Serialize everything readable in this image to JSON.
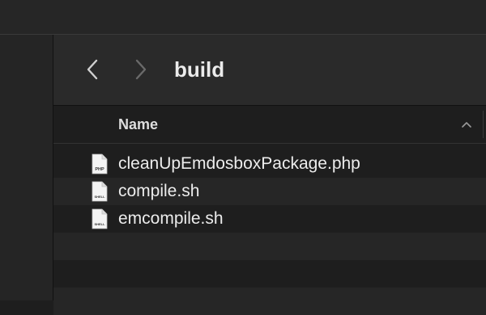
{
  "toolbar": {
    "folder_title": "build",
    "back_icon": "chevron-left-icon",
    "forward_icon": "chevron-right-icon"
  },
  "list": {
    "column_name": "Name",
    "sort": "ascending",
    "files": [
      {
        "name": "cleanUpEmdosboxPackage.php",
        "icon": "php-file-icon",
        "icon_label": "PHP"
      },
      {
        "name": "compile.sh",
        "icon": "shell-file-icon",
        "icon_label": "SHELL"
      },
      {
        "name": "emcompile.sh",
        "icon": "shell-file-icon",
        "icon_label": "SHELL"
      }
    ],
    "empty_rows": 3
  },
  "colors": {
    "background": "#1e1e1e",
    "toolbar": "#2a2a2a",
    "alt_row": "#262626",
    "text": "#ececec"
  }
}
